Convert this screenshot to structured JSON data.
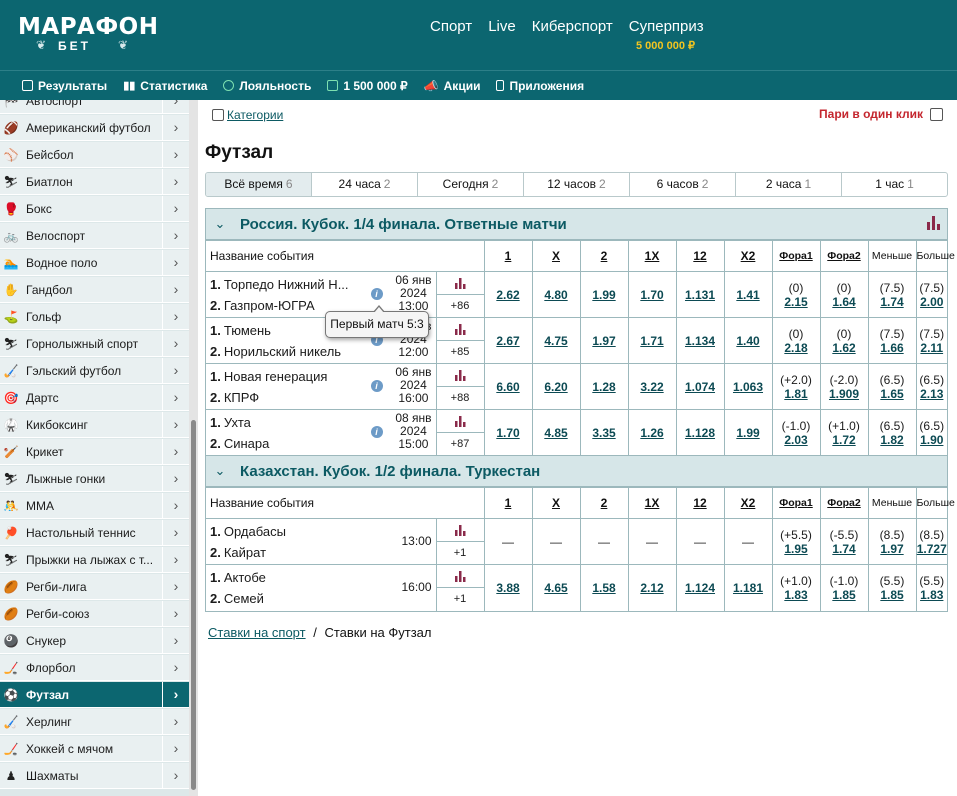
{
  "brand": {
    "logo_line1": "МАРАФОН",
    "logo_line2": "БЕТ"
  },
  "topnav": {
    "sport": "Спорт",
    "live": "Live",
    "esport": "Киберспорт",
    "superprize": "Суперприз",
    "prize_value": "5 000 000 ₽"
  },
  "nav2": {
    "results": "Результаты",
    "stats": "Статистика",
    "loyalty": "Лояльность",
    "bonus": "1 500 000 ₽",
    "promo": "Акции",
    "apps": "Приложения"
  },
  "sidebar": [
    {
      "icon": "🏁",
      "label": "Автоспорт"
    },
    {
      "icon": "🏈",
      "label": "Американский футбол"
    },
    {
      "icon": "⚾",
      "label": "Бейсбол"
    },
    {
      "icon": "⛷",
      "label": "Биатлон"
    },
    {
      "icon": "🥊",
      "label": "Бокс"
    },
    {
      "icon": "🚲",
      "label": "Велоспорт"
    },
    {
      "icon": "🏊",
      "label": "Водное поло"
    },
    {
      "icon": "✋",
      "label": "Гандбол"
    },
    {
      "icon": "⛳",
      "label": "Гольф"
    },
    {
      "icon": "⛷",
      "label": "Горнолыжный спорт"
    },
    {
      "icon": "🏑",
      "label": "Гэльский футбол"
    },
    {
      "icon": "🎯",
      "label": "Дартс"
    },
    {
      "icon": "🥋",
      "label": "Кикбоксинг"
    },
    {
      "icon": "🏏",
      "label": "Крикет"
    },
    {
      "icon": "⛷",
      "label": "Лыжные гонки"
    },
    {
      "icon": "🤼",
      "label": "ММА"
    },
    {
      "icon": "🏓",
      "label": "Настольный теннис"
    },
    {
      "icon": "⛷",
      "label": "Прыжки на лыжах с т..."
    },
    {
      "icon": "🏉",
      "label": "Регби-лига"
    },
    {
      "icon": "🏉",
      "label": "Регби-союз"
    },
    {
      "icon": "🎱",
      "label": "Снукер"
    },
    {
      "icon": "🏒",
      "label": "Флорбол"
    },
    {
      "icon": "⚽",
      "label": "Футзал",
      "active": true
    },
    {
      "icon": "🏑",
      "label": "Херлинг"
    },
    {
      "icon": "🏒",
      "label": "Хоккей с мячом"
    },
    {
      "icon": "♟",
      "label": "Шахматы"
    }
  ],
  "main": {
    "categories": "Категории",
    "one_click": "Пари в один клик",
    "title": "Футзал",
    "timefilters": [
      {
        "label": "Всё время",
        "count": "6"
      },
      {
        "label": "24 часа",
        "count": "2"
      },
      {
        "label": "Сегодня",
        "count": "2"
      },
      {
        "label": "12 часов",
        "count": "2"
      },
      {
        "label": "6 часов",
        "count": "2"
      },
      {
        "label": "2 часа",
        "count": "1"
      },
      {
        "label": "1 час",
        "count": "1"
      }
    ],
    "headers": {
      "event": "Название события",
      "c1": "1",
      "cx": "X",
      "c2": "2",
      "c1x": "1X",
      "c12": "12",
      "cx2": "X2",
      "h1": "Фора1",
      "h2": "Фора2",
      "under": "Меньше",
      "over": "Больше"
    },
    "sections": [
      {
        "name": "Россия. Кубок. 1/4 финала. Ответные матчи",
        "events": [
          {
            "n1": "1.",
            "t1": "Торпедо Нижний Н...",
            "n2": "2.",
            "t2": "Газпром-ЮГРА",
            "date": "06 янв",
            "year": "2024",
            "time": "13:00",
            "more": "+86",
            "o": [
              "2.62",
              "4.80",
              "1.99",
              "1.70",
              "1.131",
              "1.41"
            ],
            "h1v": "(0)",
            "h1o": "2.15",
            "h2v": "(0)",
            "h2o": "1.64",
            "uv": "(7.5)",
            "uo": "1.74",
            "ov": "(7.5)",
            "oo": "2.00"
          },
          {
            "n1": "1.",
            "t1": "Тюмень",
            "n2": "2.",
            "t2": "Норильский никель",
            "date": "06 янв",
            "year": "2024",
            "time": "12:00",
            "more": "+85",
            "o": [
              "2.67",
              "4.75",
              "1.97",
              "1.71",
              "1.134",
              "1.40"
            ],
            "h1v": "(0)",
            "h1o": "2.18",
            "h2v": "(0)",
            "h2o": "1.62",
            "uv": "(7.5)",
            "uo": "1.66",
            "ov": "(7.5)",
            "oo": "2.11"
          },
          {
            "n1": "1.",
            "t1": "Новая генерация",
            "n2": "2.",
            "t2": "КПРФ",
            "date": "06 янв",
            "year": "2024",
            "time": "16:00",
            "more": "+88",
            "o": [
              "6.60",
              "6.20",
              "1.28",
              "3.22",
              "1.074",
              "1.063"
            ],
            "h1v": "(+2.0)",
            "h1o": "1.81",
            "h2v": "(-2.0)",
            "h2o": "1.909",
            "uv": "(6.5)",
            "uo": "1.65",
            "ov": "(6.5)",
            "oo": "2.13"
          },
          {
            "n1": "1.",
            "t1": "Ухта",
            "n2": "2.",
            "t2": "Синара",
            "date": "08 янв",
            "year": "2024",
            "time": "15:00",
            "more": "+87",
            "o": [
              "1.70",
              "4.85",
              "3.35",
              "1.26",
              "1.128",
              "1.99"
            ],
            "h1v": "(-1.0)",
            "h1o": "2.03",
            "h2v": "(+1.0)",
            "h2o": "1.72",
            "uv": "(6.5)",
            "uo": "1.82",
            "ov": "(6.5)",
            "oo": "1.90"
          }
        ]
      },
      {
        "name": "Казахстан. Кубок. 1/2 финала. Туркестан",
        "events": [
          {
            "n1": "1.",
            "t1": "Ордабасы",
            "n2": "2.",
            "t2": "Кайрат",
            "time": "13:00",
            "more": "+1",
            "o": [
              "—",
              "—",
              "—",
              "—",
              "—",
              "—"
            ],
            "h1v": "(+5.5)",
            "h1o": "1.95",
            "h2v": "(-5.5)",
            "h2o": "1.74",
            "uv": "(8.5)",
            "uo": "1.97",
            "ov": "(8.5)",
            "oo": "1.727"
          },
          {
            "n1": "1.",
            "t1": "Актобе",
            "n2": "2.",
            "t2": "Семей",
            "time": "16:00",
            "more": "+1",
            "o": [
              "3.88",
              "4.65",
              "1.58",
              "2.12",
              "1.124",
              "1.181"
            ],
            "h1v": "(+1.0)",
            "h1o": "1.83",
            "h2v": "(-1.0)",
            "h2o": "1.85",
            "uv": "(5.5)",
            "uo": "1.85",
            "ov": "(5.5)",
            "oo": "1.83"
          }
        ]
      }
    ],
    "tooltip": "Первый матч 5:3",
    "breadcrumb": {
      "link": "Ставки на спорт",
      "sep": "/",
      "current": "Ставки на Футзал"
    }
  },
  "colors": {
    "brand": "#0c6670",
    "accent": "#f3c520",
    "red": "#c4262e"
  }
}
